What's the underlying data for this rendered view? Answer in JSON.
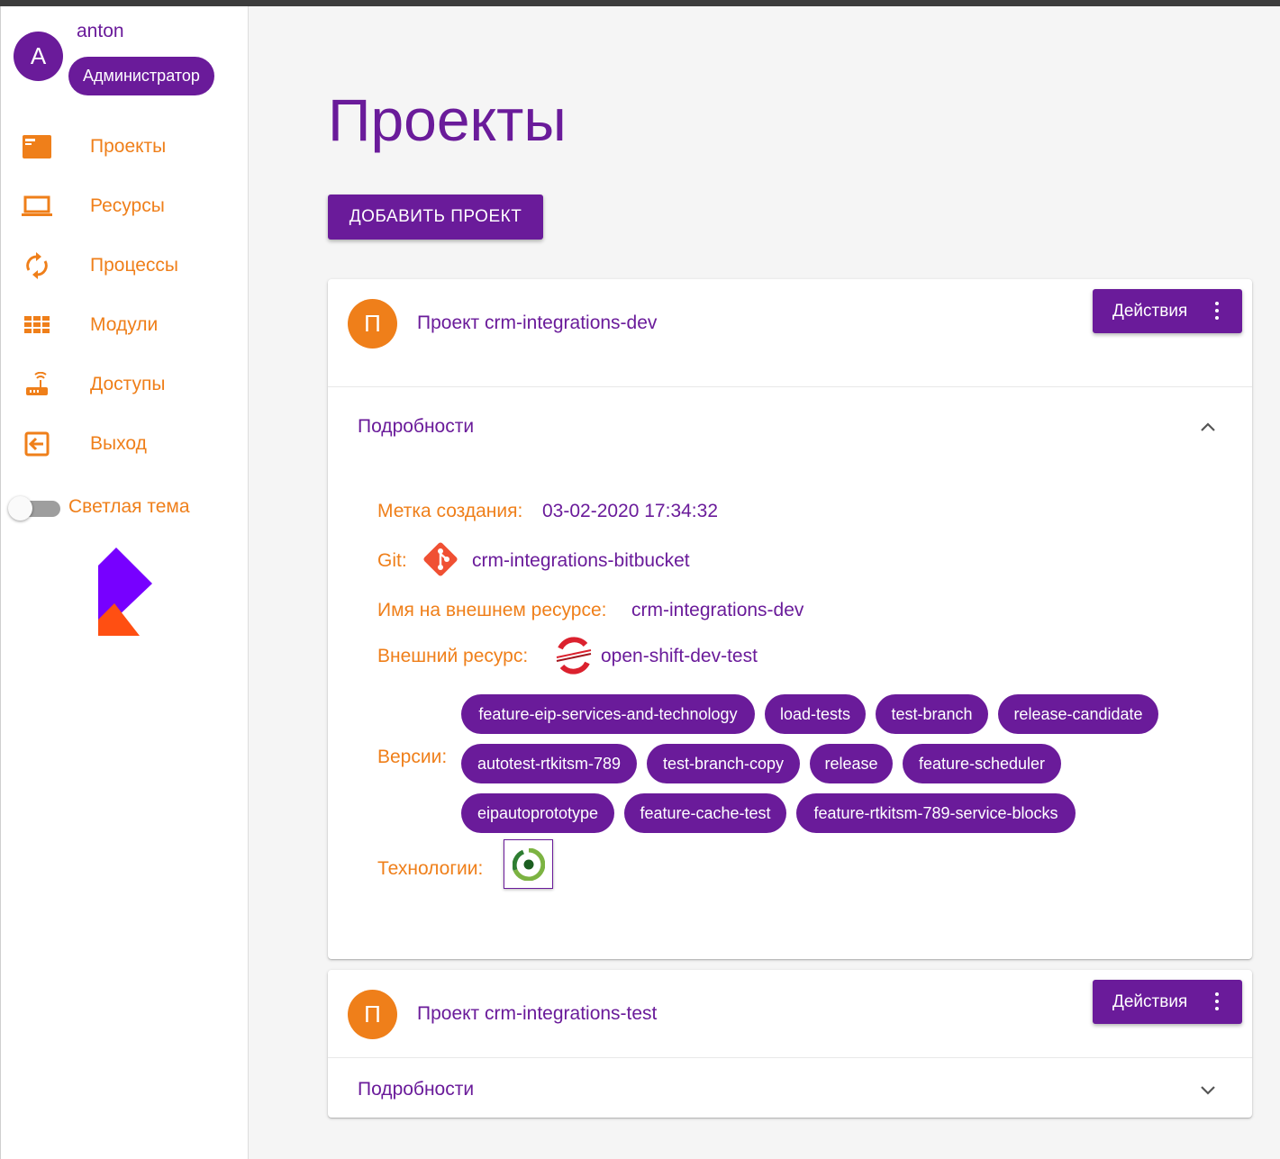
{
  "user": {
    "initial": "A",
    "name": "anton",
    "role": "Администратор"
  },
  "nav": [
    {
      "label": "Проекты",
      "icon": "projects-icon"
    },
    {
      "label": "Ресурсы",
      "icon": "laptop-icon"
    },
    {
      "label": "Процессы",
      "icon": "sync-icon"
    },
    {
      "label": "Модули",
      "icon": "modules-grid-icon"
    },
    {
      "label": "Доступы",
      "icon": "router-icon"
    },
    {
      "label": "Выход",
      "icon": "exit-icon"
    }
  ],
  "theme": {
    "label": "Светлая тема",
    "on": false
  },
  "page": {
    "title": "Проекты",
    "add_button": "ДОБАВИТЬ ПРОЕКТ"
  },
  "projects": [
    {
      "initial": "П",
      "title": "Проект crm-integrations-dev",
      "actions_label": "Действия",
      "details_label": "Подробности",
      "expanded": true,
      "created_label": "Метка создания:",
      "created_value": "03-02-2020 17:34:32",
      "git_label": "Git:",
      "git_value": "crm-integrations-bitbucket",
      "external_name_label": "Имя на внешнем ресурсе:",
      "external_name_value": "crm-integrations-dev",
      "external_resource_label": "Внешний ресурс:",
      "external_resource_value": "open-shift-dev-test",
      "versions_label": "Версии:",
      "versions": [
        "feature-eip-services-and-technology",
        "load-tests",
        "test-branch",
        "release-candidate",
        "autotest-rtkitsm-789",
        "test-branch-copy",
        "release",
        "feature-scheduler",
        "eipautoprototype",
        "feature-cache-test",
        "feature-rtkitsm-789-service-blocks"
      ],
      "technologies_label": "Технологии:",
      "technologies": [
        "circleci-icon"
      ]
    },
    {
      "initial": "П",
      "title": "Проект crm-integrations-test",
      "actions_label": "Действия",
      "details_label": "Подробности",
      "expanded": false
    }
  ],
  "colors": {
    "primary": "#6a1b9a",
    "accent": "#ef7f1a"
  }
}
